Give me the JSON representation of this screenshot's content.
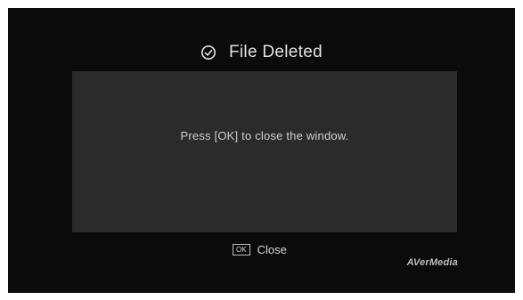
{
  "dialog": {
    "title": "File Deleted",
    "title_icon": "check-circle-icon",
    "message": "Press [OK] to close the window.",
    "ok_key_label": "OK",
    "close_label": "Close"
  },
  "brand": {
    "logo_text": "AVerMedia"
  },
  "colors": {
    "screen_background": "#0b0b0b",
    "panel_background": "#2b2b2b",
    "text": "#e2e2e2"
  }
}
